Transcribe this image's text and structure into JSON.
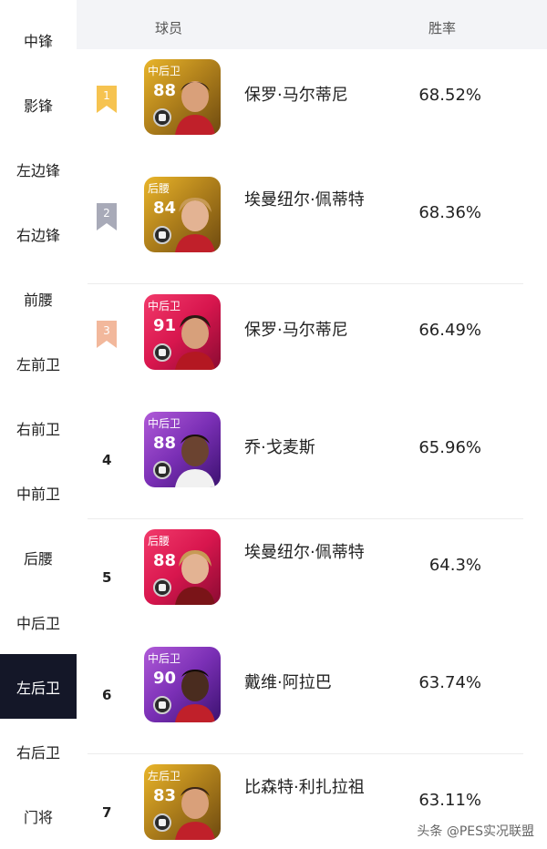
{
  "sidebar": {
    "items": [
      {
        "label": "中锋"
      },
      {
        "label": "影锋"
      },
      {
        "label": "左边锋"
      },
      {
        "label": "右边锋"
      },
      {
        "label": "前腰"
      },
      {
        "label": "左前卫"
      },
      {
        "label": "右前卫"
      },
      {
        "label": "中前卫"
      },
      {
        "label": "后腰"
      },
      {
        "label": "中后卫"
      },
      {
        "label": "左后卫"
      },
      {
        "label": "右后卫"
      },
      {
        "label": "门将"
      }
    ],
    "active": "左后卫",
    "active_color": "#141728"
  },
  "table": {
    "header_player": "球员",
    "header_rate": "胜率",
    "rows": [
      {
        "rank": "1",
        "position": "中后卫",
        "rating": "88",
        "name": "保罗·马尔蒂尼",
        "win_rate": "68.52%",
        "card_color": "gold",
        "badge_color": "#f6c350"
      },
      {
        "rank": "2",
        "position": "后腰",
        "rating": "84",
        "name": "埃曼纽尔·佩蒂特",
        "win_rate": "68.36%",
        "card_color": "gold",
        "badge_color": "#a8aab8"
      },
      {
        "rank": "3",
        "position": "中后卫",
        "rating": "91",
        "name": "保罗·马尔蒂尼",
        "win_rate": "66.49%",
        "card_color": "pink",
        "badge_color": "#f2b89c"
      },
      {
        "rank": "4",
        "position": "中后卫",
        "rating": "88",
        "name": "乔·戈麦斯",
        "win_rate": "65.96%",
        "card_color": "purple"
      },
      {
        "rank": "5",
        "position": "后腰",
        "rating": "88",
        "name": "埃曼纽尔·佩蒂特",
        "win_rate": "64.3%",
        "card_color": "pink"
      },
      {
        "rank": "6",
        "position": "中后卫",
        "rating": "90",
        "name": "戴维·阿拉巴",
        "win_rate": "63.74%",
        "card_color": "purple"
      },
      {
        "rank": "7",
        "position": "左后卫",
        "rating": "83",
        "name": "比森特·利扎拉祖",
        "win_rate": "63.11%",
        "card_color": "gold"
      }
    ]
  },
  "watermark": "头条 @PES实况联盟"
}
